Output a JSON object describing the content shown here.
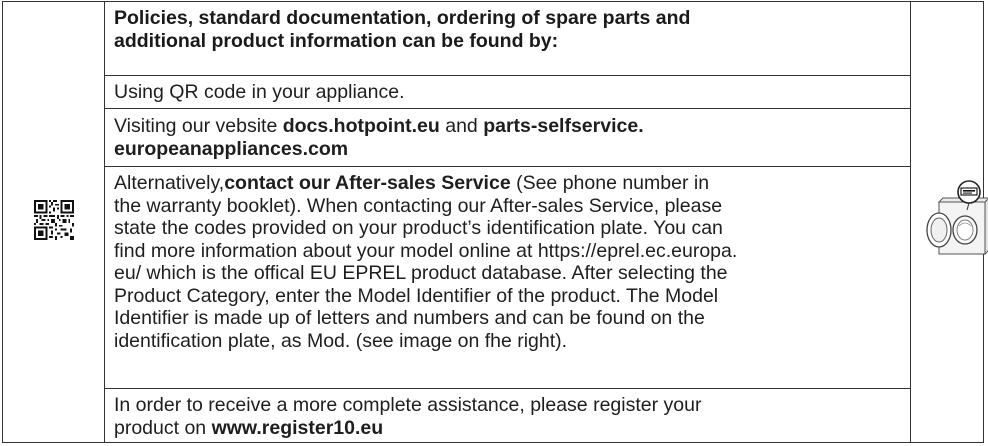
{
  "heading": {
    "line1": "Policies, standard documentation, ordering of spare parts and",
    "line2": "additional product information can be found by:"
  },
  "qr_text": {
    "text": "Using QR code in your appliance."
  },
  "website": {
    "prefix": "Visiting our vebsite ",
    "site1": "docs.hotpoint.eu",
    "mid": " and ",
    "site2_line1": "parts-selfservice.",
    "site2_line2": "europeanappliances.com"
  },
  "aftersales": {
    "prefix": "Alternatively,",
    "bold": "contact our After-sales Service",
    "l1_rest": " (See phone number in",
    "l2": "the warranty booklet). When contacting our After-sales Service, please",
    "l3": "state the codes provided on your product’s identification plate. You can",
    "l4": "find more information about your model online at https://eprel.ec.europa.",
    "l5": "eu/ which is the offical EU EPREL product database. After selecting  the",
    "l6": "Product Category, enter the Model Identifier  of the product. The Model",
    "l7": "Identifier is made up of letters and numbers and can be found on the",
    "l8": "identification plate, as Mod. (see image on fhe right)."
  },
  "register": {
    "line1": "In order to receive a more complete assistance, please register your",
    "prefix2": "product on ",
    "url": "www.register10.eu"
  },
  "icons": {
    "qr": "qr-code-icon",
    "washer": "washing-machine-icon"
  },
  "colors": {
    "text": "#1e1e1e",
    "border": "#333333"
  }
}
